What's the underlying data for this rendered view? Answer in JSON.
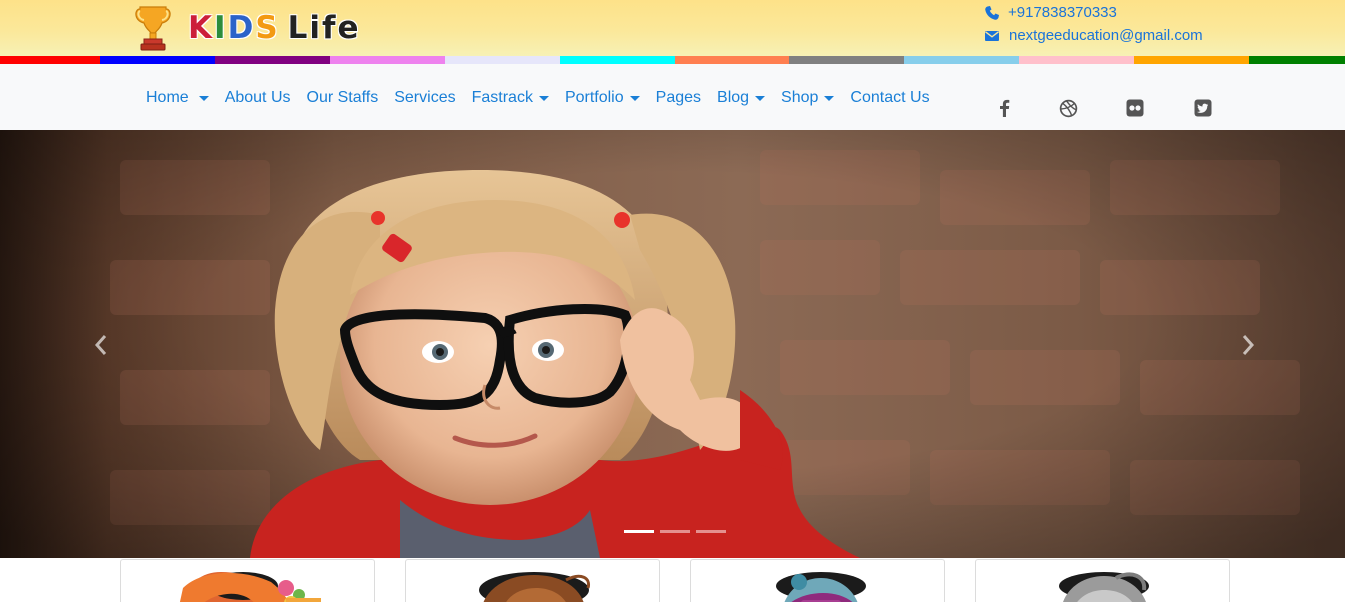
{
  "brand": {
    "letters": [
      {
        "char": "K",
        "color": "#cc1f3a"
      },
      {
        "char": "I",
        "color": "#2d8d3b"
      },
      {
        "char": "D",
        "color": "#2b63c9"
      },
      {
        "char": "S",
        "color": "#f39a12"
      },
      {
        "char": "L",
        "color": "#222222"
      },
      {
        "char": "i",
        "color": "#222222"
      },
      {
        "char": "f",
        "color": "#222222"
      },
      {
        "char": "e",
        "color": "#222222"
      }
    ],
    "trophy_icon": "trophy-icon"
  },
  "contact": {
    "phone": "+917838370333",
    "email": "nextgeeducation@gmail.com",
    "phone_icon": "phone-icon",
    "email_icon": "envelope-icon",
    "color": "#1a73d9"
  },
  "stripe_colors": [
    "#ff0000",
    "#0000ff",
    "#800080",
    "#ee82ee",
    "#e6e6fa",
    "#00ffff",
    "#ff7f50",
    "#808080",
    "#87ceeb",
    "#ffc0cb",
    "#ffa500",
    "#008000"
  ],
  "nav": {
    "items": [
      {
        "label": "Home",
        "dropdown": true
      },
      {
        "label": "About Us",
        "dropdown": false
      },
      {
        "label": "Our Staffs",
        "dropdown": false
      },
      {
        "label": "Services",
        "dropdown": false
      },
      {
        "label": "Fastrack",
        "dropdown": true
      },
      {
        "label": "Portfolio",
        "dropdown": true
      },
      {
        "label": "Pages",
        "dropdown": false
      },
      {
        "label": "Blog",
        "dropdown": true
      },
      {
        "label": "Shop",
        "dropdown": true
      },
      {
        "label": "Contact Us",
        "dropdown": false
      }
    ],
    "social": [
      "facebook-icon",
      "dribbble-icon",
      "flickr-icon",
      "twitter-icon"
    ],
    "link_color": "#1a7fd6"
  },
  "hero": {
    "image": "girl-with-glasses-photo",
    "prev_icon": "chevron-left-icon",
    "next_icon": "chevron-right-icon",
    "slide_count": 3,
    "active_slide": 1
  },
  "cards": {
    "count": 4
  }
}
